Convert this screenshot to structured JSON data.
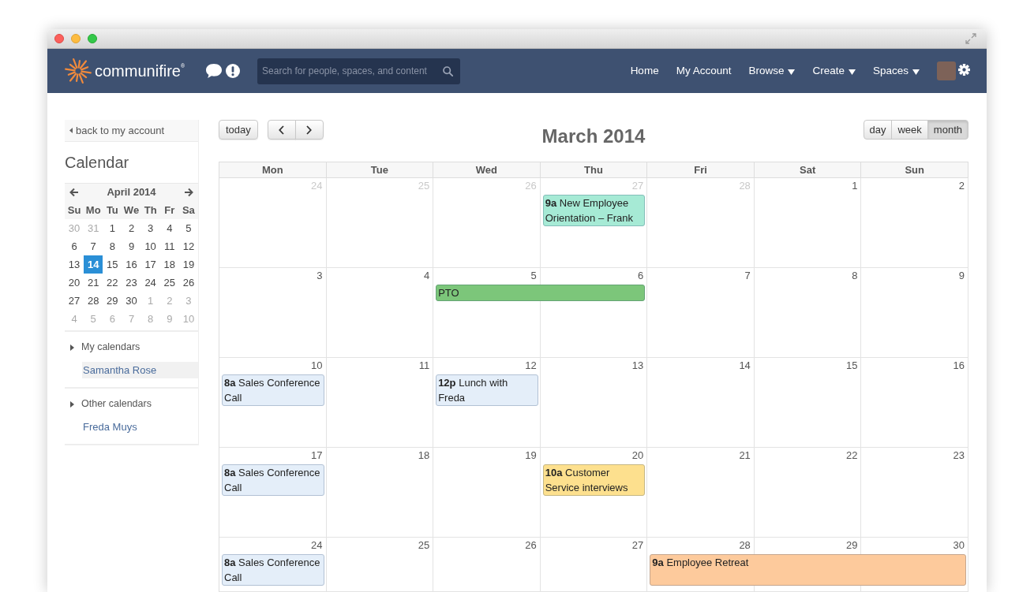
{
  "navbar": {
    "logo": "communifire$^{®}$",
    "search": {
      "placeholder": "Search for people, spaces, and content"
    },
    "links": [
      {
        "label": "Home",
        "dropdown": false
      },
      {
        "label": "My Account",
        "dropdown": false
      },
      {
        "label": "Browse",
        "dropdown": true
      },
      {
        "label": "Create",
        "dropdown": true
      },
      {
        "label": "Spaces",
        "dropdown": true
      }
    ]
  },
  "sidebar": {
    "back_link": "back to my account",
    "title": "Calendar",
    "mini_calendar": {
      "month": "April 2014",
      "weekdays": [
        "Su",
        "Mo",
        "Tu",
        "We",
        "Th",
        "Fr",
        "Sa"
      ],
      "weeks": [
        {
          "days": [
            {
              "label": "30",
              "other_month": true,
              "selected": false
            },
            {
              "label": "31",
              "other_month": true,
              "selected": false
            },
            {
              "label": "1",
              "other_month": false,
              "selected": false
            },
            {
              "label": "2",
              "other_month": false,
              "selected": false
            },
            {
              "label": "3",
              "other_month": false,
              "selected": false
            },
            {
              "label": "4",
              "other_month": false,
              "selected": false
            },
            {
              "label": "5",
              "other_month": false,
              "selected": false
            }
          ]
        },
        {
          "days": [
            {
              "label": "6",
              "other_month": false,
              "selected": false
            },
            {
              "label": "7",
              "other_month": false,
              "selected": false
            },
            {
              "label": "8",
              "other_month": false,
              "selected": false
            },
            {
              "label": "9",
              "other_month": false,
              "selected": false
            },
            {
              "label": "10",
              "other_month": false,
              "selected": false
            },
            {
              "label": "11",
              "other_month": false,
              "selected": false
            },
            {
              "label": "12",
              "other_month": false,
              "selected": false
            }
          ]
        },
        {
          "days": [
            {
              "label": "13",
              "other_month": false,
              "selected": false
            },
            {
              "label": "14",
              "other_month": false,
              "selected": true
            },
            {
              "label": "15",
              "other_month": false,
              "selected": false
            },
            {
              "label": "16",
              "other_month": false,
              "selected": false
            },
            {
              "label": "17",
              "other_month": false,
              "selected": false
            },
            {
              "label": "18",
              "other_month": false,
              "selected": false
            },
            {
              "label": "19",
              "other_month": false,
              "selected": false
            }
          ]
        },
        {
          "days": [
            {
              "label": "20",
              "other_month": false,
              "selected": false
            },
            {
              "label": "21",
              "other_month": false,
              "selected": false
            },
            {
              "label": "22",
              "other_month": false,
              "selected": false
            },
            {
              "label": "23",
              "other_month": false,
              "selected": false
            },
            {
              "label": "24",
              "other_month": false,
              "selected": false
            },
            {
              "label": "25",
              "other_month": false,
              "selected": false
            },
            {
              "label": "26",
              "other_month": false,
              "selected": false
            }
          ]
        },
        {
          "days": [
            {
              "label": "27",
              "other_month": false,
              "selected": false
            },
            {
              "label": "28",
              "other_month": false,
              "selected": false
            },
            {
              "label": "29",
              "other_month": false,
              "selected": false
            },
            {
              "label": "30",
              "other_month": false,
              "selected": false
            },
            {
              "label": "1",
              "other_month": true,
              "selected": false
            },
            {
              "label": "2",
              "other_month": true,
              "selected": false
            },
            {
              "label": "3",
              "other_month": true,
              "selected": false
            }
          ]
        },
        {
          "days": [
            {
              "label": "4",
              "other_month": true,
              "selected": false
            },
            {
              "label": "5",
              "other_month": true,
              "selected": false
            },
            {
              "label": "6",
              "other_month": true,
              "selected": false
            },
            {
              "label": "7",
              "other_month": true,
              "selected": false
            },
            {
              "label": "8",
              "other_month": true,
              "selected": false
            },
            {
              "label": "9",
              "other_month": true,
              "selected": false
            },
            {
              "label": "10",
              "other_month": true,
              "selected": false
            }
          ]
        }
      ]
    },
    "sections": [
      {
        "title": "My calendars",
        "items": [
          {
            "label": "Samantha Rose",
            "selected": true
          }
        ]
      },
      {
        "title": "Other calendars",
        "items": [
          {
            "label": "Freda Muys",
            "selected": false
          }
        ]
      }
    ]
  },
  "calendar": {
    "today_button": "today",
    "title": "March 2014",
    "views": [
      {
        "label": "day",
        "selected": false
      },
      {
        "label": "week",
        "selected": false
      },
      {
        "label": "month",
        "selected": true
      }
    ],
    "weekdays": [
      "Mon",
      "Tue",
      "Wed",
      "Thu",
      "Fri",
      "Sat",
      "Sun"
    ],
    "weeks": [
      {
        "days": [
          {
            "label": "24",
            "other_month": true
          },
          {
            "label": "25",
            "other_month": true
          },
          {
            "label": "26",
            "other_month": true
          },
          {
            "label": "27",
            "other_month": true,
            "events": [
              {
                "kind": "single",
                "time": "9a",
                "title": "New Employee Orientation – Frank",
                "color": "#a6ead5"
              }
            ]
          },
          {
            "label": "28",
            "other_month": true
          },
          {
            "label": "1",
            "other_month": false
          },
          {
            "label": "2",
            "other_month": false
          }
        ]
      },
      {
        "days": [
          {
            "label": "3",
            "other_month": false
          },
          {
            "label": "4",
            "other_month": false
          },
          {
            "label": "5",
            "other_month": false,
            "events": [
              {
                "kind": "double",
                "title": "PTO",
                "color": "#7cc67a"
              }
            ]
          },
          {
            "label": "6",
            "other_month": false
          },
          {
            "label": "7",
            "other_month": false
          },
          {
            "label": "8",
            "other_month": false
          },
          {
            "label": "9",
            "other_month": false
          }
        ]
      },
      {
        "days": [
          {
            "label": "10",
            "other_month": false,
            "events": [
              {
                "kind": "single",
                "time": "8a",
                "title": "Sales Conference Call",
                "color": "#e4eef9"
              }
            ]
          },
          {
            "label": "11",
            "other_month": false
          },
          {
            "label": "12",
            "other_month": false,
            "events": [
              {
                "kind": "single",
                "time": "12p",
                "title": "Lunch with Freda",
                "color": "#e4eef9"
              }
            ]
          },
          {
            "label": "13",
            "other_month": false
          },
          {
            "label": "14",
            "other_month": false
          },
          {
            "label": "15",
            "other_month": false
          },
          {
            "label": "16",
            "other_month": false
          }
        ]
      },
      {
        "days": [
          {
            "label": "17",
            "other_month": false,
            "events": [
              {
                "kind": "single",
                "time": "8a",
                "title": "Sales Conference Call",
                "color": "#e4eef9"
              }
            ]
          },
          {
            "label": "18",
            "other_month": false
          },
          {
            "label": "19",
            "other_month": false
          },
          {
            "label": "20",
            "other_month": false,
            "events": [
              {
                "kind": "single",
                "time": "10a",
                "title": "Customer Service interviews",
                "color": "#fde08e"
              }
            ]
          },
          {
            "label": "21",
            "other_month": false
          },
          {
            "label": "22",
            "other_month": false
          },
          {
            "label": "23",
            "other_month": false
          }
        ]
      },
      {
        "days": [
          {
            "label": "24",
            "other_month": false,
            "events": [
              {
                "kind": "single",
                "time": "8a",
                "title": "Sales Conference Call",
                "color": "#e4eef9"
              }
            ]
          },
          {
            "label": "25",
            "other_month": false
          },
          {
            "label": "26",
            "other_month": false
          },
          {
            "label": "27",
            "other_month": false
          },
          {
            "label": "28",
            "other_month": false,
            "events": [
              {
                "kind": "triple",
                "time": "9a",
                "title": "Employee Retreat",
                "color": "#fdca9c"
              }
            ]
          },
          {
            "label": "29",
            "other_month": false
          },
          {
            "label": "30",
            "other_month": false
          }
        ]
      }
    ]
  }
}
